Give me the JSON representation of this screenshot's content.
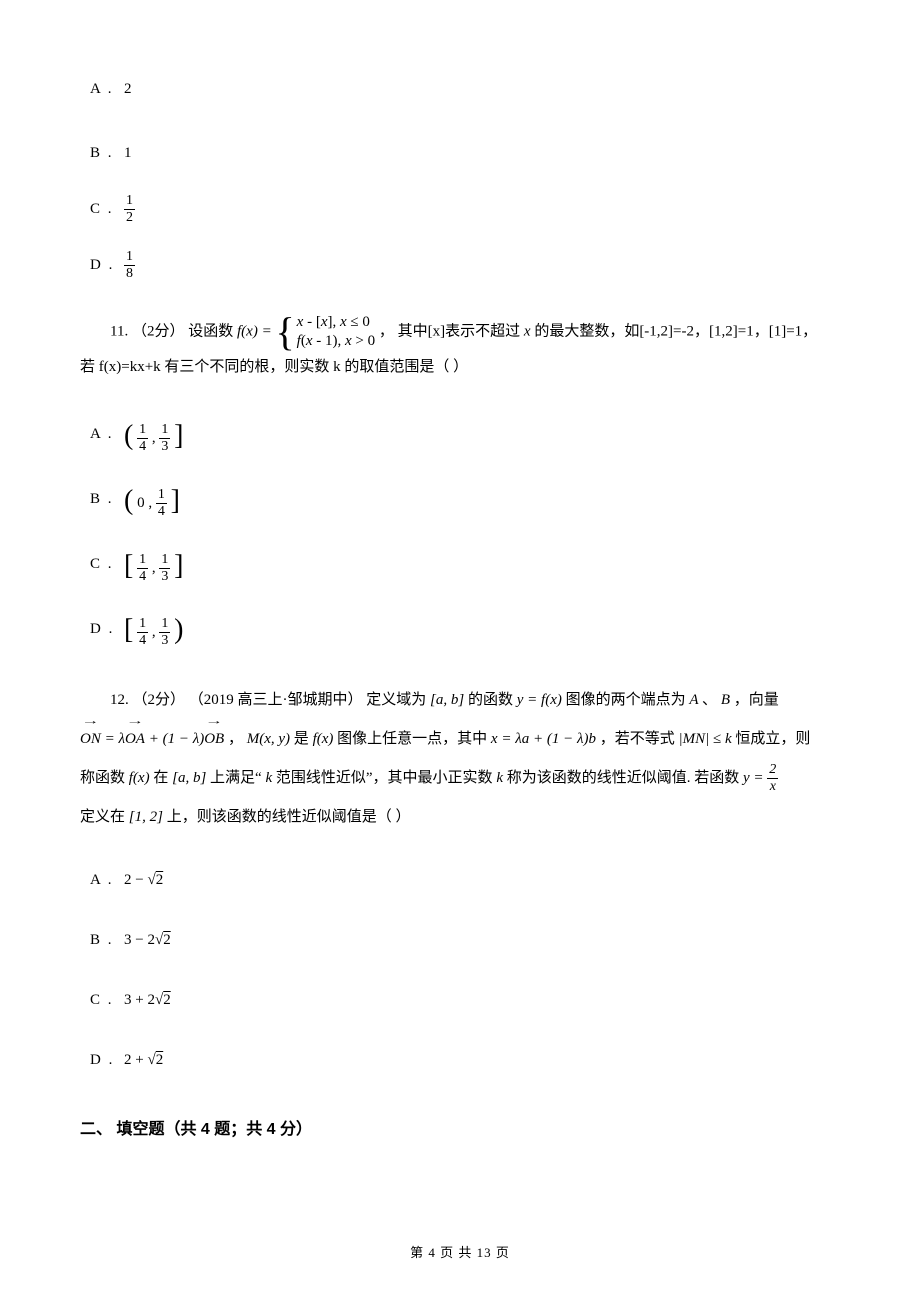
{
  "q10": {
    "options": {
      "A": {
        "label": "A .",
        "value_text": "2"
      },
      "B": {
        "label": "B .",
        "value_text": "1"
      },
      "C": {
        "label": "C .",
        "frac_num": "1",
        "frac_den": "2"
      },
      "D": {
        "label": "D .",
        "frac_num": "1",
        "frac_den": "8"
      }
    }
  },
  "q11": {
    "number": "11.",
    "points": "（2分）",
    "stem_pre": "设函数",
    "func_lhs": "f(x) =",
    "piece1": "x - [x], x ≤ 0",
    "piece2": "f(x - 1), x > 0",
    "stem_mid1": "，  其中[x]表示不超过",
    "var_x": "x",
    "stem_mid2": "的最大整数，如[-1,2]=-2，[1,2]=1，[1]=1，",
    "stem_line2": "若 f(x)=kx+k 有三个不同的根，则实数 k 的取值范围是（    ）",
    "options": {
      "A": {
        "label": "A .",
        "left_br": "(",
        "a_num": "1",
        "a_den": "4",
        "sep": ",",
        "b_num": "1",
        "b_den": "3",
        "right_br": "]"
      },
      "B": {
        "label": "B .",
        "left_br": "(",
        "a_text": "0",
        "sep": ",",
        "b_num": "1",
        "b_den": "4",
        "right_br": "]"
      },
      "C": {
        "label": "C .",
        "left_br": "[",
        "a_num": "1",
        "a_den": "4",
        "sep": ",",
        "b_num": "1",
        "b_den": "3",
        "right_br": "]"
      },
      "D": {
        "label": "D .",
        "left_br": "[",
        "a_num": "1",
        "a_den": "4",
        "sep": ",",
        "b_num": "1",
        "b_den": "3",
        "right_br": ")"
      }
    }
  },
  "q12": {
    "number": "12.",
    "points": "（2分）",
    "source": "（2019 高三上·邹城期中）",
    "t1": "定义域为",
    "interval1": "[a, b]",
    "t2": "的函数",
    "func": "y = f(x)",
    "t3": "图像的两个端点为",
    "pA": "A",
    "t4": " 、 ",
    "pB": "B",
    "t5": " ，向量",
    "vec_eq": "ON = λOA + (1 − λ)OB",
    "t6": " ，  ",
    "Mxy": "M(x, y)",
    "t7": " 是 ",
    "fx2": "f(x)",
    "t8": " 图像上任意一点，其中 ",
    "x_eq": "x = λa + (1 − λ)b",
    "t9": " ，若不等式 ",
    "mn_ineq": "|MN| ≤ k",
    "t10": " 恒成立，则",
    "t11": "称函数",
    "fx3": "f(x)",
    "t12": " 在 ",
    "interval2": "[a, b]",
    "t13": " 上满足“ ",
    "k1": "k",
    "t14": " 范围线性近似”，其中最小正实数 ",
    "k2": "k",
    "t15": " 称为该函数的线性近似阈值. 若函数 ",
    "y_eq_num": "2",
    "y_eq_den": "x",
    "y_eq_pre": "y =",
    "t16": "定义在",
    "interval3": "[1, 2]",
    "t17": " 上，则该函数的线性近似阈值是（    ）",
    "options": {
      "A": {
        "label": "A .",
        "expr": "2 − √2"
      },
      "B": {
        "label": "B .",
        "expr": "3 − 2√2"
      },
      "C": {
        "label": "C .",
        "expr": "3 + 2√2"
      },
      "D": {
        "label": "D .",
        "expr": "2 + √2"
      }
    }
  },
  "section2": "二、 填空题（共 4 题；共 4 分）",
  "footer": {
    "pre": "第 ",
    "cur": "4",
    "mid": " 页 共 ",
    "total": "13",
    "suf": " 页"
  }
}
